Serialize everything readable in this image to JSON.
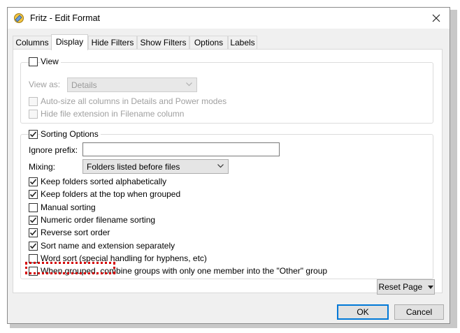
{
  "window": {
    "title": "Fritz - Edit Format"
  },
  "tabs": [
    {
      "label": "Columns"
    },
    {
      "label": "Display"
    },
    {
      "label": "Hide Filters"
    },
    {
      "label": "Show Filters"
    },
    {
      "label": "Options"
    },
    {
      "label": "Labels"
    }
  ],
  "view_group": {
    "checkbox_label": "View",
    "checked": false,
    "view_as_label": "View as:",
    "view_as_value": "Details",
    "autosize_label": "Auto-size all columns in Details and Power modes",
    "hide_ext_label": "Hide file extension in Filename column"
  },
  "sorting_group": {
    "checkbox_label": "Sorting Options",
    "checked": true,
    "ignore_prefix_label": "Ignore prefix:",
    "ignore_prefix_value": "",
    "mixing_label": "Mixing:",
    "mixing_value": "Folders listed before files",
    "options": [
      {
        "label": "Keep folders sorted alphabetically",
        "checked": true
      },
      {
        "label": "Keep folders at the top when grouped",
        "checked": true
      },
      {
        "label": "Manual sorting",
        "checked": false
      },
      {
        "label": "Numeric order filename sorting",
        "checked": true
      },
      {
        "label": "Reverse sort order",
        "checked": true
      },
      {
        "label": "Sort name and extension separately",
        "checked": true
      },
      {
        "label": "Word sort (special handling for hyphens, etc)",
        "checked": false
      },
      {
        "label": "When grouped, combine groups with only one member into the \"Other\" group",
        "checked": false
      }
    ]
  },
  "buttons": {
    "reset_page": "Reset Page",
    "ok": "OK",
    "cancel": "Cancel"
  },
  "colors": {
    "highlight": "#d40000",
    "default_button_border": "#0078d7"
  }
}
